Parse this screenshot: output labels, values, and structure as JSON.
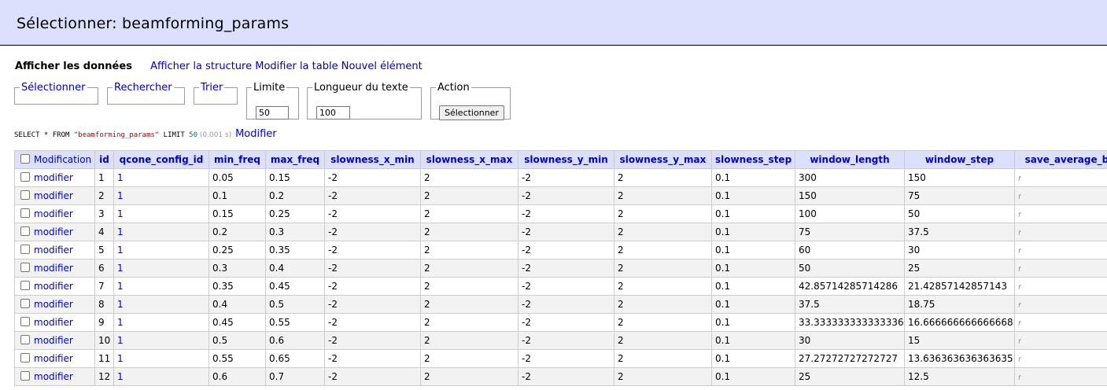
{
  "header": {
    "title": "Sélectionner: beamforming_params"
  },
  "menu": {
    "items": [
      "Afficher les données",
      "Afficher la structure",
      "Modifier la table",
      "Nouvel élément"
    ]
  },
  "controls": {
    "select_legend": "Sélectionner",
    "search_legend": "Rechercher",
    "sort_legend": "Trier",
    "limit_legend": "Limite",
    "limit_value": "50",
    "text_length_legend": "Longueur du texte",
    "text_length_value": "100",
    "action_legend": "Action",
    "action_button": "Sélectionner"
  },
  "sql": {
    "prefix": "SELECT * FROM ",
    "table": "\"beamforming_params\"",
    "limit_kw": " LIMIT ",
    "limit": "50",
    "time": " (0.001 s) ",
    "edit_link": "Modifier"
  },
  "table": {
    "columns": [
      "Modification",
      "id",
      "qcone_config_id",
      "min_freq",
      "max_freq",
      "slowness_x_min",
      "slowness_x_max",
      "slowness_y_min",
      "slowness_y_max",
      "slowness_step",
      "window_length",
      "window_step",
      "save_average_be"
    ],
    "edit_label": "modifier",
    "rows": [
      [
        "1",
        "1",
        "0.05",
        "0.15",
        "-2",
        "2",
        "-2",
        "2",
        "0.1",
        "300",
        "150",
        "f"
      ],
      [
        "2",
        "1",
        "0.1",
        "0.2",
        "-2",
        "2",
        "-2",
        "2",
        "0.1",
        "150",
        "75",
        "f"
      ],
      [
        "3",
        "1",
        "0.15",
        "0.25",
        "-2",
        "2",
        "-2",
        "2",
        "0.1",
        "100",
        "50",
        "f"
      ],
      [
        "4",
        "1",
        "0.2",
        "0.3",
        "-2",
        "2",
        "-2",
        "2",
        "0.1",
        "75",
        "37.5",
        "f"
      ],
      [
        "5",
        "1",
        "0.25",
        "0.35",
        "-2",
        "2",
        "-2",
        "2",
        "0.1",
        "60",
        "30",
        "f"
      ],
      [
        "6",
        "1",
        "0.3",
        "0.4",
        "-2",
        "2",
        "-2",
        "2",
        "0.1",
        "50",
        "25",
        "f"
      ],
      [
        "7",
        "1",
        "0.35",
        "0.45",
        "-2",
        "2",
        "-2",
        "2",
        "0.1",
        "42.85714285714286",
        "21.42857142857143",
        "f"
      ],
      [
        "8",
        "1",
        "0.4",
        "0.5",
        "-2",
        "2",
        "-2",
        "2",
        "0.1",
        "37.5",
        "18.75",
        "f"
      ],
      [
        "9",
        "1",
        "0.45",
        "0.55",
        "-2",
        "2",
        "-2",
        "2",
        "0.1",
        "33.333333333333336",
        "16.666666666666668",
        "f"
      ],
      [
        "10",
        "1",
        "0.5",
        "0.6",
        "-2",
        "2",
        "-2",
        "2",
        "0.1",
        "30",
        "15",
        "f"
      ],
      [
        "11",
        "1",
        "0.55",
        "0.65",
        "-2",
        "2",
        "-2",
        "2",
        "0.1",
        "27.27272727272727",
        "13.636363636363635",
        "f"
      ],
      [
        "12",
        "1",
        "0.6",
        "0.7",
        "-2",
        "2",
        "-2",
        "2",
        "0.1",
        "25",
        "12.5",
        "f"
      ]
    ]
  }
}
